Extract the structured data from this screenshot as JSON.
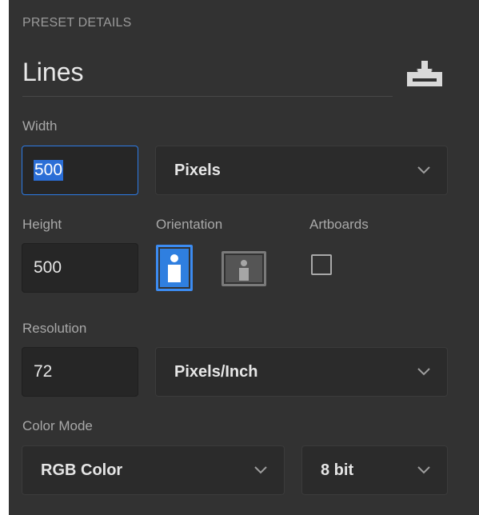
{
  "section_title": "PRESET DETAILS",
  "preset_name": "Lines",
  "icons": {
    "save_preset": "save-preset-icon",
    "chevron": "chevron-down-icon"
  },
  "width": {
    "label": "Width",
    "value": "500",
    "unit": "Pixels"
  },
  "height": {
    "label": "Height",
    "value": "500"
  },
  "orientation": {
    "label": "Orientation",
    "selected": "portrait"
  },
  "artboards": {
    "label": "Artboards",
    "checked": false
  },
  "resolution": {
    "label": "Resolution",
    "value": "72",
    "unit": "Pixels/Inch"
  },
  "color_mode": {
    "label": "Color Mode",
    "mode": "RGB Color",
    "depth": "8 bit"
  },
  "colors": {
    "accent": "#3c8cf2",
    "panel_bg": "#323232"
  }
}
